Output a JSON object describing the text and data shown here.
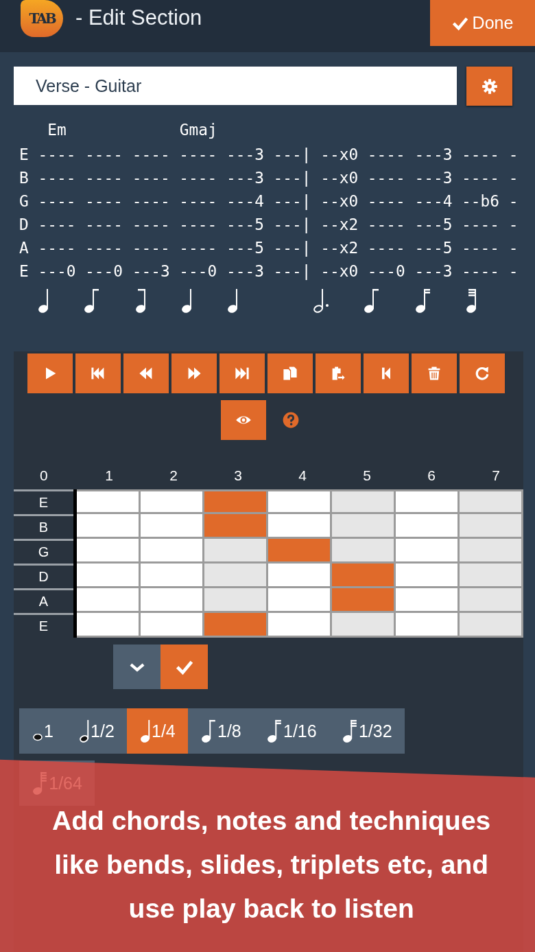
{
  "header": {
    "logo": "TAB",
    "title": "- Edit Section",
    "done_button": "Done"
  },
  "section_name": {
    "value": "Verse - Guitar"
  },
  "tab": {
    "chords": [
      {
        "name": "Em"
      },
      {
        "name": "Gmaj"
      }
    ],
    "lines": [
      {
        "string": "E",
        "notation": "---- ---- ---- ---- ---3 ---| --x0 ---- ---3 ---- -"
      },
      {
        "string": "B",
        "notation": "---- ---- ---- ---- ---3 ---| --x0 ---- ---3 ---- -"
      },
      {
        "string": "G",
        "notation": "---- ---- ---- ---- ---4 ---| --x0 ---- ---4 --b6 -"
      },
      {
        "string": "D",
        "notation": "---- ---- ---- ---- ---5 ---| --x2 ---- ---5 ---- -"
      },
      {
        "string": "A",
        "notation": "---- ---- ---- ---- ---5 ---| --x2 ---- ---5 ---- -"
      },
      {
        "string": "E",
        "notation": "---0 ---0 ---3 ---0 ---3 ---| --x0 ---0 ---3 ---- -"
      }
    ],
    "measures": [
      {
        "notes": [
          {
            "kind": "quarter"
          },
          {
            "kind": "eighth"
          },
          {
            "kind": "eighth-end"
          },
          {
            "kind": "quarter"
          },
          {
            "kind": "quarter"
          }
        ]
      },
      {
        "notes": [
          {
            "kind": "dotted-half"
          },
          {
            "kind": "eighth"
          },
          {
            "kind": "sixteenth"
          },
          {
            "kind": "thirtysecond-end"
          }
        ]
      }
    ]
  },
  "toolbar": [
    {
      "kind": "play"
    },
    {
      "kind": "skip-back"
    },
    {
      "kind": "rewind"
    },
    {
      "kind": "fast-forward"
    },
    {
      "kind": "skip-forward"
    },
    {
      "kind": "copy"
    },
    {
      "kind": "paste"
    },
    {
      "kind": "step-back"
    },
    {
      "kind": "trash"
    },
    {
      "kind": "redo"
    }
  ],
  "toolbar_2": [
    {
      "kind": "eye"
    },
    {
      "kind": "help"
    }
  ],
  "fretboard": {
    "frets": [
      "0",
      "1",
      "2",
      "3",
      "4",
      "5",
      "6",
      "7"
    ],
    "strings": [
      {
        "name": "E",
        "cells": [
          {
            "selected": false,
            "shaded": false
          },
          {
            "selected": false,
            "shaded": false
          },
          {
            "selected": true,
            "shaded": false
          },
          {
            "selected": false,
            "shaded": false
          },
          {
            "selected": false,
            "shaded": true
          },
          {
            "selected": false,
            "shaded": false
          },
          {
            "selected": false,
            "shaded": true
          }
        ]
      },
      {
        "name": "B",
        "cells": [
          {
            "selected": false,
            "shaded": false
          },
          {
            "selected": false,
            "shaded": false
          },
          {
            "selected": true,
            "shaded": false
          },
          {
            "selected": false,
            "shaded": false
          },
          {
            "selected": false,
            "shaded": true
          },
          {
            "selected": false,
            "shaded": false
          },
          {
            "selected": false,
            "shaded": true
          }
        ]
      },
      {
        "name": "G",
        "cells": [
          {
            "selected": false,
            "shaded": false
          },
          {
            "selected": false,
            "shaded": false
          },
          {
            "selected": false,
            "shaded": true
          },
          {
            "selected": true,
            "shaded": false
          },
          {
            "selected": false,
            "shaded": true
          },
          {
            "selected": false,
            "shaded": false
          },
          {
            "selected": false,
            "shaded": true
          }
        ]
      },
      {
        "name": "D",
        "cells": [
          {
            "selected": false,
            "shaded": false
          },
          {
            "selected": false,
            "shaded": false
          },
          {
            "selected": false,
            "shaded": true
          },
          {
            "selected": false,
            "shaded": false
          },
          {
            "selected": true,
            "shaded": false
          },
          {
            "selected": false,
            "shaded": false
          },
          {
            "selected": false,
            "shaded": true
          }
        ]
      },
      {
        "name": "A",
        "cells": [
          {
            "selected": false,
            "shaded": false
          },
          {
            "selected": false,
            "shaded": false
          },
          {
            "selected": false,
            "shaded": true
          },
          {
            "selected": false,
            "shaded": false
          },
          {
            "selected": true,
            "shaded": false
          },
          {
            "selected": false,
            "shaded": false
          },
          {
            "selected": false,
            "shaded": true
          }
        ]
      },
      {
        "name": "E",
        "cells": [
          {
            "selected": false,
            "shaded": false
          },
          {
            "selected": false,
            "shaded": false
          },
          {
            "selected": true,
            "shaded": false
          },
          {
            "selected": false,
            "shaded": false
          },
          {
            "selected": false,
            "shaded": true
          },
          {
            "selected": false,
            "shaded": false
          },
          {
            "selected": false,
            "shaded": true
          }
        ]
      }
    ]
  },
  "actions": [
    {
      "kind": "chevron-down"
    },
    {
      "kind": "check"
    }
  ],
  "durations": [
    {
      "label": "1",
      "kind": "whole",
      "selected": false
    },
    {
      "label": "1/2",
      "kind": "half",
      "selected": false
    },
    {
      "label": "1/4",
      "kind": "quarter",
      "selected": true
    },
    {
      "label": "1/8",
      "kind": "eighth",
      "selected": false
    },
    {
      "label": "1/16",
      "kind": "sixteenth",
      "selected": false
    },
    {
      "label": "1/32",
      "kind": "thirtysecond",
      "selected": false
    },
    {
      "label": "1/64",
      "kind": "sixtyfourth",
      "selected": false
    }
  ],
  "banner": {
    "text": "Add chords, notes and techniques like bends, slides, triplets etc, and use play back to listen"
  }
}
